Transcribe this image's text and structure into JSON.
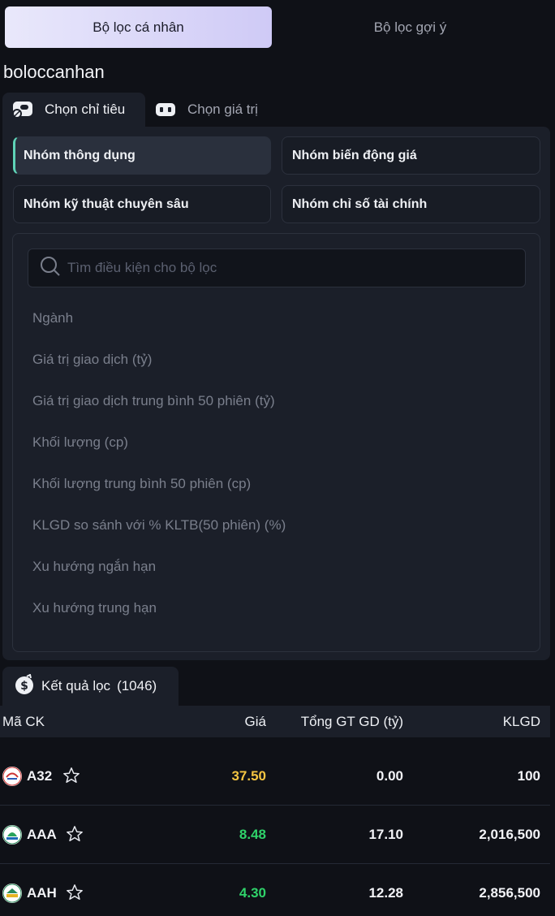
{
  "top_tabs": {
    "personal": "Bộ lọc cá nhân",
    "suggested": "Bộ lọc gợi ý"
  },
  "filter_name": "boloccanhan",
  "sub_tabs": {
    "choose_criteria": "Chọn chỉ tiêu",
    "choose_value": "Chọn giá trị"
  },
  "groups": {
    "common": "Nhóm thông dụng",
    "price_change": "Nhóm biến động giá",
    "technical": "Nhóm kỹ thuật chuyên sâu",
    "financial": "Nhóm chỉ số tài chính"
  },
  "search": {
    "placeholder": "Tìm điều kiện cho bộ lọc"
  },
  "criteria": [
    "Ngành",
    "Giá trị giao dịch (tỷ)",
    "Giá trị giao dịch trung bình 50 phiên (tỷ)",
    "Khối lượng (cp)",
    "Khối lượng trung bình 50 phiên (cp)",
    "KLGD so sánh với % KLTB(50 phiên) (%)",
    "Xu hướng ngắn hạn",
    "Xu hướng trung hạn"
  ],
  "results": {
    "label": "Kết quả lọc",
    "count": "(1046)"
  },
  "table": {
    "headers": {
      "ticker": "Mã CK",
      "price": "Giá",
      "total_value": "Tổng GT GD (tỷ)",
      "volume": "KLGD"
    },
    "rows": [
      {
        "ticker": "A32",
        "price": "37.50",
        "price_color": "#f5c542",
        "total_value": "0.00",
        "volume": "100"
      },
      {
        "ticker": "AAA",
        "price": "8.48",
        "price_color": "#2fd36a",
        "total_value": "17.10",
        "volume": "2,016,500"
      },
      {
        "ticker": "AAH",
        "price": "4.30",
        "price_color": "#2fd36a",
        "total_value": "12.28",
        "volume": "2,856,500"
      }
    ]
  },
  "colors": {
    "accent": "#5fd3b7",
    "background": "#0f1117",
    "panel": "#1b1f29"
  },
  "icons": {
    "criteria_tab": "pill-icon",
    "value_tab": "toggle-icon",
    "results": "money-bag-icon",
    "search": "search-icon",
    "favorite": "star-icon"
  }
}
